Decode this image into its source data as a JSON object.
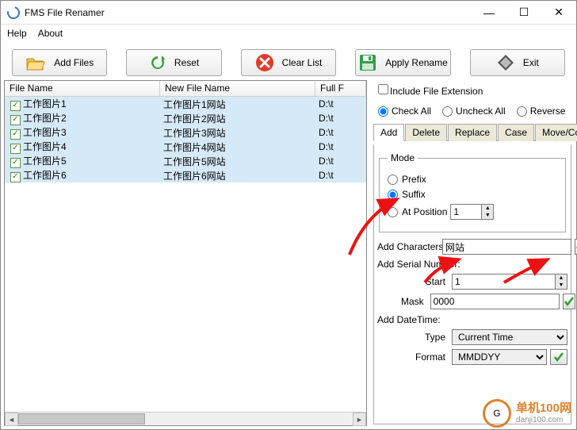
{
  "window": {
    "title": "FMS File Renamer"
  },
  "menu": {
    "help": "Help",
    "about": "About"
  },
  "toolbar": {
    "addFiles": "Add Files",
    "reset": "Reset",
    "clearList": "Clear List",
    "applyRename": "Apply Rename",
    "exit": "Exit"
  },
  "list": {
    "headers": {
      "fileName": "File Name",
      "newFileName": "New File Name",
      "fullPath": "Full F"
    },
    "rows": [
      {
        "old": "工作图片1",
        "new": "工作图片1网站",
        "path": "D:\\t"
      },
      {
        "old": "工作图片2",
        "new": "工作图片2网站",
        "path": "D:\\t"
      },
      {
        "old": "工作图片3",
        "new": "工作图片3网站",
        "path": "D:\\t"
      },
      {
        "old": "工作图片4",
        "new": "工作图片4网站",
        "path": "D:\\t"
      },
      {
        "old": "工作图片5",
        "new": "工作图片5网站",
        "path": "D:\\t"
      },
      {
        "old": "工作图片6",
        "new": "工作图片6网站",
        "path": "D:\\t"
      }
    ]
  },
  "options": {
    "includeExt": "Include File Extension",
    "checkAll": "Check All",
    "uncheckAll": "Uncheck All",
    "reverse": "Reverse"
  },
  "tabs": {
    "add": "Add",
    "delete": "Delete",
    "replace": "Replace",
    "case": "Case",
    "moveCopy": "Move/Copy"
  },
  "addTab": {
    "modeLegend": "Mode",
    "prefix": "Prefix",
    "suffix": "Suffix",
    "atPosition": "At Position",
    "atPositionValue": "1",
    "addChars": "Add Characters:",
    "addCharsValue": "网站",
    "addSerial": "Add Serial Number:",
    "start": "Start",
    "startValue": "1",
    "mask": "Mask",
    "maskValue": "0000",
    "addDateTime": "Add DateTime:",
    "type": "Type",
    "typeValue": "Current Time",
    "format": "Format",
    "formatValue": "MMDDYY"
  },
  "watermark": {
    "brand": "单机100网",
    "domain": "danji100.com",
    "logo": "G"
  }
}
